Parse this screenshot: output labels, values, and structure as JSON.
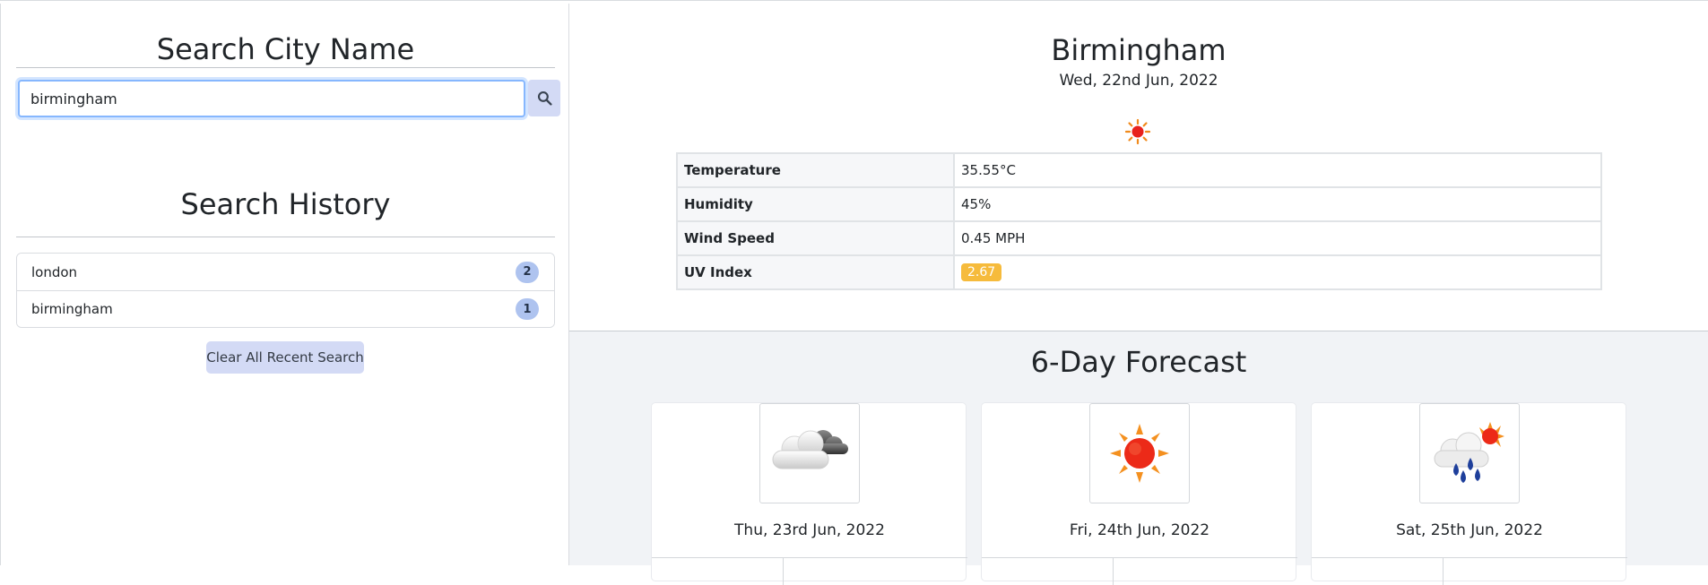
{
  "search": {
    "title": "Search City Name",
    "input_value": "birmingham",
    "button_icon": "search-icon"
  },
  "history": {
    "title": "Search History",
    "items": [
      {
        "label": "london",
        "count": "2"
      },
      {
        "label": "birmingham",
        "count": "1"
      }
    ],
    "clear_label": "Clear All Recent Search"
  },
  "current": {
    "city": "Birmingham",
    "date": "Wed, 22nd Jun, 2022",
    "icon": "sun-icon",
    "rows": [
      {
        "label": "Temperature",
        "value": "35.55°C"
      },
      {
        "label": "Humidity",
        "value": "45%"
      },
      {
        "label": "Wind Speed",
        "value": "0.45 MPH"
      },
      {
        "label": "UV Index",
        "value": "2.67"
      }
    ],
    "uv_color": "#f6bb3c"
  },
  "forecast": {
    "title": "6-Day Forecast",
    "cards": [
      {
        "date": "Thu, 23rd Jun, 2022",
        "icon": "cloud-icon"
      },
      {
        "date": "Fri, 24th Jun, 2022",
        "icon": "sun-icon"
      },
      {
        "date": "Sat, 25th Jun, 2022",
        "icon": "rain-sun-icon"
      }
    ]
  },
  "colors": {
    "accent_button": "#d3daf5",
    "badge": "#aec3ef",
    "forecast_bg": "#f1f3f6"
  }
}
